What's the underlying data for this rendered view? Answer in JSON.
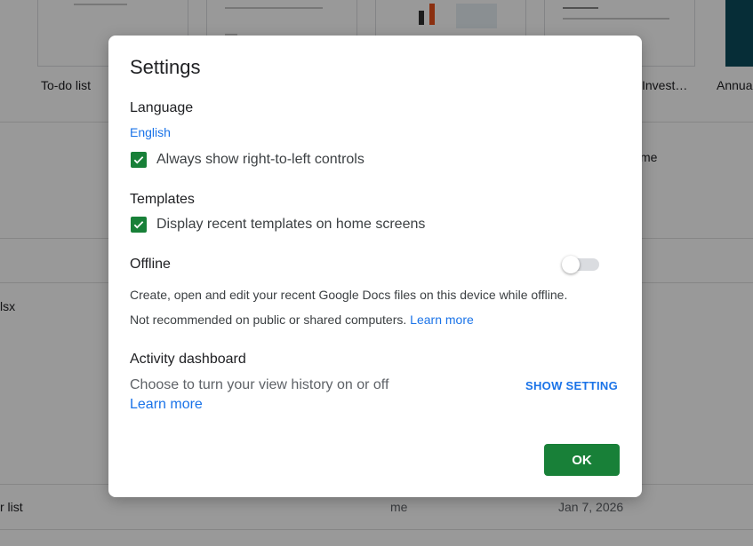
{
  "background": {
    "thumbnails": [
      {
        "caption": "To-do list"
      },
      {
        "caption": ""
      },
      {
        "caption": ""
      },
      {
        "caption": "Invest…"
      },
      {
        "caption": "Annua"
      }
    ],
    "texts": {
      "owner_header_partial": "me",
      "file_partial_1": "lsx",
      "file_partial_2": "r list",
      "owner_value": "me",
      "date_value": "Jan 7, 2026"
    }
  },
  "dialog": {
    "title": "Settings",
    "language": {
      "heading": "Language",
      "value": "English",
      "rtl_label": "Always show right-to-left controls",
      "rtl_checked": true
    },
    "templates": {
      "heading": "Templates",
      "recent_label": "Display recent templates on home screens",
      "recent_checked": true
    },
    "offline": {
      "heading": "Offline",
      "enabled": false,
      "description": "Create, open and edit your recent Google Docs files on this device while offline.",
      "warning": "Not recommended on public or shared computers.",
      "learn_more": "Learn more"
    },
    "activity": {
      "heading": "Activity dashboard",
      "description": "Choose to turn your view history on or off",
      "learn_more": "Learn more",
      "show_setting": "SHOW SETTING"
    },
    "ok_label": "OK"
  },
  "colors": {
    "accent_green": "#188038",
    "link_blue": "#1a73e8"
  }
}
